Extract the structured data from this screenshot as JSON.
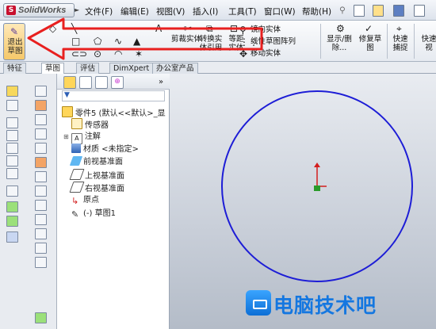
{
  "app": {
    "logo_text": "SolidWorks",
    "logo_mark": "S"
  },
  "menu": {
    "items": [
      "文件(F)",
      "编辑(E)",
      "视图(V)",
      "插入(I)",
      "工具(T)",
      "窗口(W)",
      "帮助(H)"
    ]
  },
  "ribbon": {
    "sketch_button": "退出草图",
    "trim": "剪裁实体",
    "convert": "转换实体引用",
    "offset": "等距实体",
    "mirror": "镜向实体",
    "linear_pattern": "线性草图阵列",
    "move": "移动实体",
    "display_delete": "显示/删除...",
    "repair": "修复草图",
    "quick_snap": "快速捕捉",
    "quick_view": "快速视"
  },
  "tabs": [
    "特征",
    "草图",
    "评估",
    "DimXpert",
    "办公室产品"
  ],
  "tree": {
    "root": "零件5 (默认<<默认>_显",
    "items": [
      "传感器",
      "注解",
      "材质 <未指定>",
      "前视基准面",
      "上视基准面",
      "右视基准面",
      "原点",
      "(-) 草图1"
    ]
  },
  "watermark": {
    "text": "电脑技术吧"
  },
  "colors": {
    "annotation_arrow": "#e8201f",
    "circle": "#1d1dd6",
    "origin_x": "#2a9a2a",
    "origin_y": "#d31e1e",
    "watermark": "#1577e0"
  },
  "icons": [
    "sketch-icon",
    "line-icon",
    "rectangle-icon",
    "arc-icon",
    "spline-icon",
    "trim-icon",
    "convert-icon",
    "offset-icon",
    "mirror-icon",
    "pattern-icon",
    "display-delete-icon",
    "repair-icon",
    "snap-icon",
    "filter-icon"
  ]
}
